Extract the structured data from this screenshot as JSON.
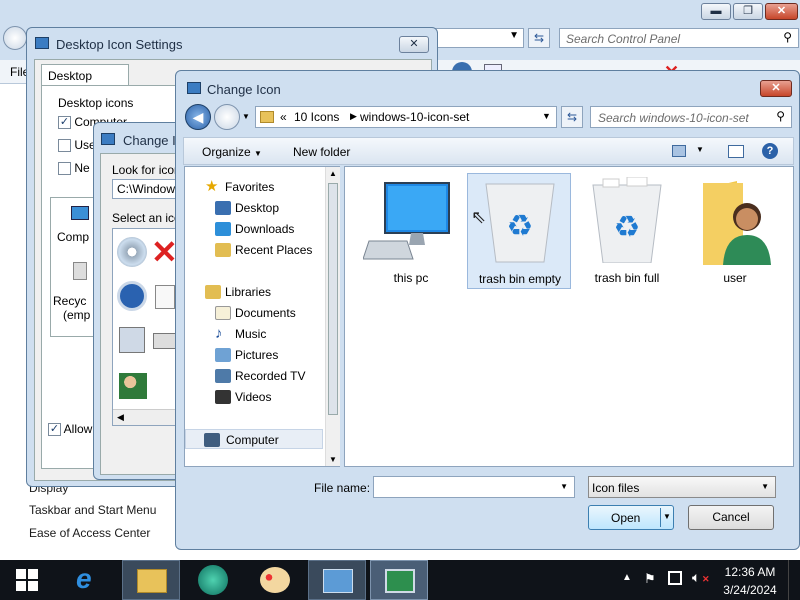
{
  "control_panel": {
    "search_placeholder": "Search Control Panel",
    "menu_file": "File",
    "links": [
      "Display",
      "Taskbar and Start Menu",
      "Ease of Access Center"
    ]
  },
  "desktop_icon_settings": {
    "title": "Desktop Icon Settings",
    "tab": "Desktop Icons",
    "group_label": "Desktop icons",
    "checkboxes": [
      "Computer",
      "Use",
      "Ne"
    ],
    "icon_labels": [
      "Comp",
      "Recyc",
      "(emp"
    ],
    "allow_label": "Allow"
  },
  "change_icon_small": {
    "title": "Change Ic",
    "look_for_label": "Look for icons",
    "path_value": "C:\\Windows",
    "select_label": "Select an icon"
  },
  "dialog": {
    "title": "Change Icon",
    "breadcrumb": [
      "«",
      "10 Icons",
      "windows-10-icon-set"
    ],
    "search_placeholder": "Search windows-10-icon-set",
    "organize": "Organize",
    "new_folder": "New folder",
    "nav": {
      "favorites": "Favorites",
      "desktop": "Desktop",
      "downloads": "Downloads",
      "recent_places": "Recent Places",
      "libraries": "Libraries",
      "documents": "Documents",
      "music": "Music",
      "pictures": "Pictures",
      "recorded_tv": "Recorded TV",
      "videos": "Videos",
      "computer": "Computer"
    },
    "files": [
      "this pc",
      "trash bin empty",
      "trash bin full",
      "user"
    ],
    "file_name_label": "File name:",
    "file_name_value": "",
    "file_type": "Icon files",
    "open": "Open",
    "cancel": "Cancel"
  },
  "taskbar": {
    "time": "12:36 AM",
    "date": "3/24/2024"
  },
  "colors": {
    "accent": "#2b5797",
    "selection": "#dbe9f8",
    "title_text": "#1f2f45"
  }
}
